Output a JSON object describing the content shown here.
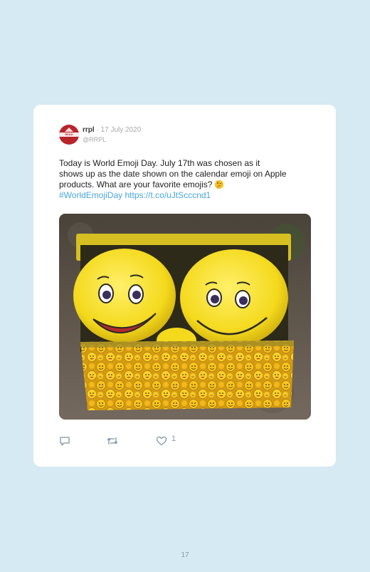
{
  "tweet": {
    "username": "rrpl",
    "date": "17 July 2020",
    "handle": "@RRPL",
    "avatar_text": "READ TOWN",
    "text_line1": "Today is World Emoji Day. July 17th was chosen as it",
    "text_line2": "shows up as the date shown on the calendar emoji on Apple",
    "text_line3": "products. What are your favorite emojis?",
    "hashtag": "#WorldEmojiDay",
    "link": "https://t.co/uJtScccnd1",
    "likes": "1",
    "image_alt": "Two smiling yellow plush emoji toys sitting in a tin box decorated with emojis"
  },
  "icons": {
    "reply": "reply-icon",
    "retweet": "retweet-icon",
    "like": "heart-icon",
    "thinking": "thinking-face-emoji"
  },
  "colors": {
    "page_background": "#d5eaf2",
    "card": "#ffffff",
    "link": "#48a6dd",
    "avatar": "#b8242b"
  },
  "page_number": "17"
}
